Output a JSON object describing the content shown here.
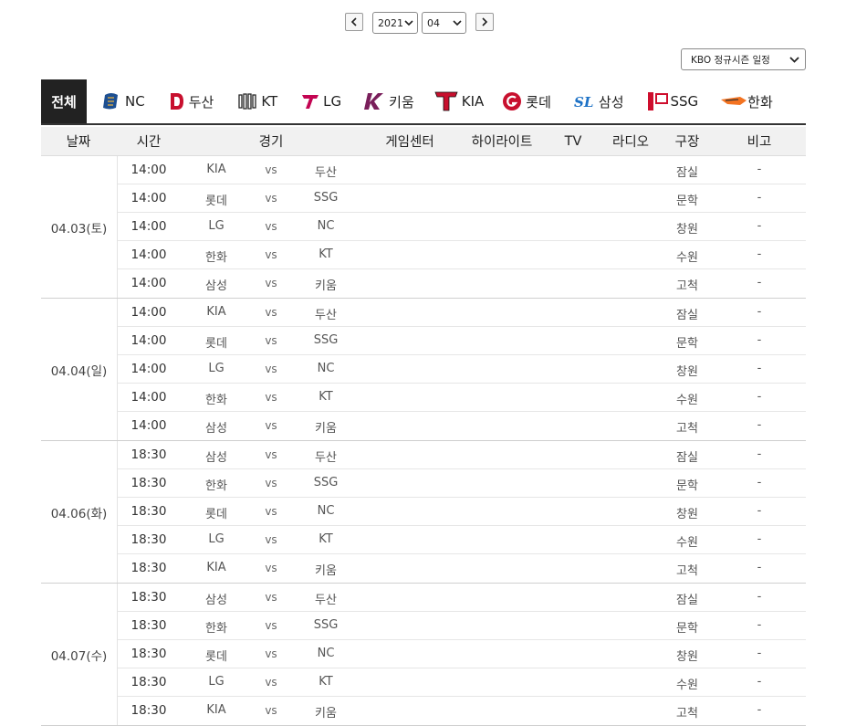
{
  "nav": {
    "prev_label": "‹",
    "next_label": "›",
    "year": "2021",
    "month": "04",
    "season_select": "KBO 정규시즌 일정"
  },
  "tabs": [
    {
      "label": "전체",
      "logo": "",
      "color": "#222222"
    },
    {
      "label": "NC",
      "logo": "nc-logo-icon",
      "color": "#1d4f91"
    },
    {
      "label": "두산",
      "logo": "doosan-logo-icon",
      "color": "#c8102e"
    },
    {
      "label": "KT",
      "logo": "kt-logo-icon",
      "color": "#222222"
    },
    {
      "label": "LG",
      "logo": "lg-logo-icon",
      "color": "#c30452"
    },
    {
      "label": "키움",
      "logo": "kiwoom-logo-icon",
      "color": "#7a1f5b"
    },
    {
      "label": "KIA",
      "logo": "kia-logo-icon",
      "color": "#c8102e"
    },
    {
      "label": "롯데",
      "logo": "lotte-logo-icon",
      "color": "#c8102e"
    },
    {
      "label": "삼성",
      "logo": "samsung-logo-icon",
      "color": "#1e72c6"
    },
    {
      "label": "SSG",
      "logo": "ssg-logo-icon",
      "color": "#ce0e2d"
    },
    {
      "label": "한화",
      "logo": "hanwha-logo-icon",
      "color": "#f37321"
    }
  ],
  "headers": [
    "날짜",
    "시간",
    "경기",
    "게임센터",
    "하이라이트",
    "TV",
    "라디오",
    "구장",
    "비고"
  ],
  "vs_label": "vs",
  "days": [
    {
      "date": "04.03(토)",
      "games": [
        {
          "time": "14:00",
          "away": "KIA",
          "home": "두산",
          "stadium": "잠실",
          "note": "-"
        },
        {
          "time": "14:00",
          "away": "롯데",
          "home": "SSG",
          "stadium": "문학",
          "note": "-"
        },
        {
          "time": "14:00",
          "away": "LG",
          "home": "NC",
          "stadium": "창원",
          "note": "-"
        },
        {
          "time": "14:00",
          "away": "한화",
          "home": "KT",
          "stadium": "수원",
          "note": "-"
        },
        {
          "time": "14:00",
          "away": "삼성",
          "home": "키움",
          "stadium": "고척",
          "note": "-"
        }
      ]
    },
    {
      "date": "04.04(일)",
      "games": [
        {
          "time": "14:00",
          "away": "KIA",
          "home": "두산",
          "stadium": "잠실",
          "note": "-"
        },
        {
          "time": "14:00",
          "away": "롯데",
          "home": "SSG",
          "stadium": "문학",
          "note": "-"
        },
        {
          "time": "14:00",
          "away": "LG",
          "home": "NC",
          "stadium": "창원",
          "note": "-"
        },
        {
          "time": "14:00",
          "away": "한화",
          "home": "KT",
          "stadium": "수원",
          "note": "-"
        },
        {
          "time": "14:00",
          "away": "삼성",
          "home": "키움",
          "stadium": "고척",
          "note": "-"
        }
      ]
    },
    {
      "date": "04.06(화)",
      "games": [
        {
          "time": "18:30",
          "away": "삼성",
          "home": "두산",
          "stadium": "잠실",
          "note": "-"
        },
        {
          "time": "18:30",
          "away": "한화",
          "home": "SSG",
          "stadium": "문학",
          "note": "-"
        },
        {
          "time": "18:30",
          "away": "롯데",
          "home": "NC",
          "stadium": "창원",
          "note": "-"
        },
        {
          "time": "18:30",
          "away": "LG",
          "home": "KT",
          "stadium": "수원",
          "note": "-"
        },
        {
          "time": "18:30",
          "away": "KIA",
          "home": "키움",
          "stadium": "고척",
          "note": "-"
        }
      ]
    },
    {
      "date": "04.07(수)",
      "games": [
        {
          "time": "18:30",
          "away": "삼성",
          "home": "두산",
          "stadium": "잠실",
          "note": "-"
        },
        {
          "time": "18:30",
          "away": "한화",
          "home": "SSG",
          "stadium": "문학",
          "note": "-"
        },
        {
          "time": "18:30",
          "away": "롯데",
          "home": "NC",
          "stadium": "창원",
          "note": "-"
        },
        {
          "time": "18:30",
          "away": "LG",
          "home": "KT",
          "stadium": "수원",
          "note": "-"
        },
        {
          "time": "18:30",
          "away": "KIA",
          "home": "키움",
          "stadium": "고척",
          "note": "-"
        }
      ]
    }
  ]
}
